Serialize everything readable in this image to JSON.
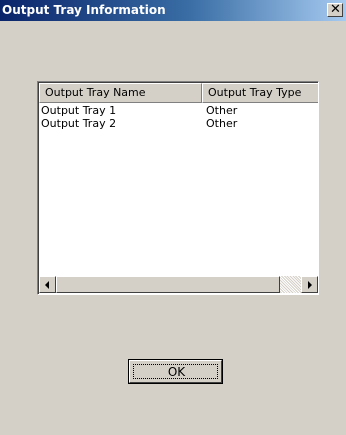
{
  "window": {
    "title": "Output Tray Information",
    "close_icon": "close-icon",
    "close_glyph": "✕"
  },
  "listview": {
    "columns": [
      {
        "label": "Output Tray Name"
      },
      {
        "label": "Output Tray Type"
      }
    ],
    "rows": [
      {
        "name": "Output Tray 1",
        "type": "Other"
      },
      {
        "name": "Output Tray 2",
        "type": "Other"
      }
    ],
    "scrollbar": {
      "left_icon": "arrow-left-icon",
      "right_icon": "arrow-right-icon"
    }
  },
  "buttons": {
    "ok_label": "OK"
  },
  "colors": {
    "title_bar_start": "#0a246a",
    "title_bar_end": "#a6caf0",
    "dialog_face": "#d4d0c8"
  }
}
